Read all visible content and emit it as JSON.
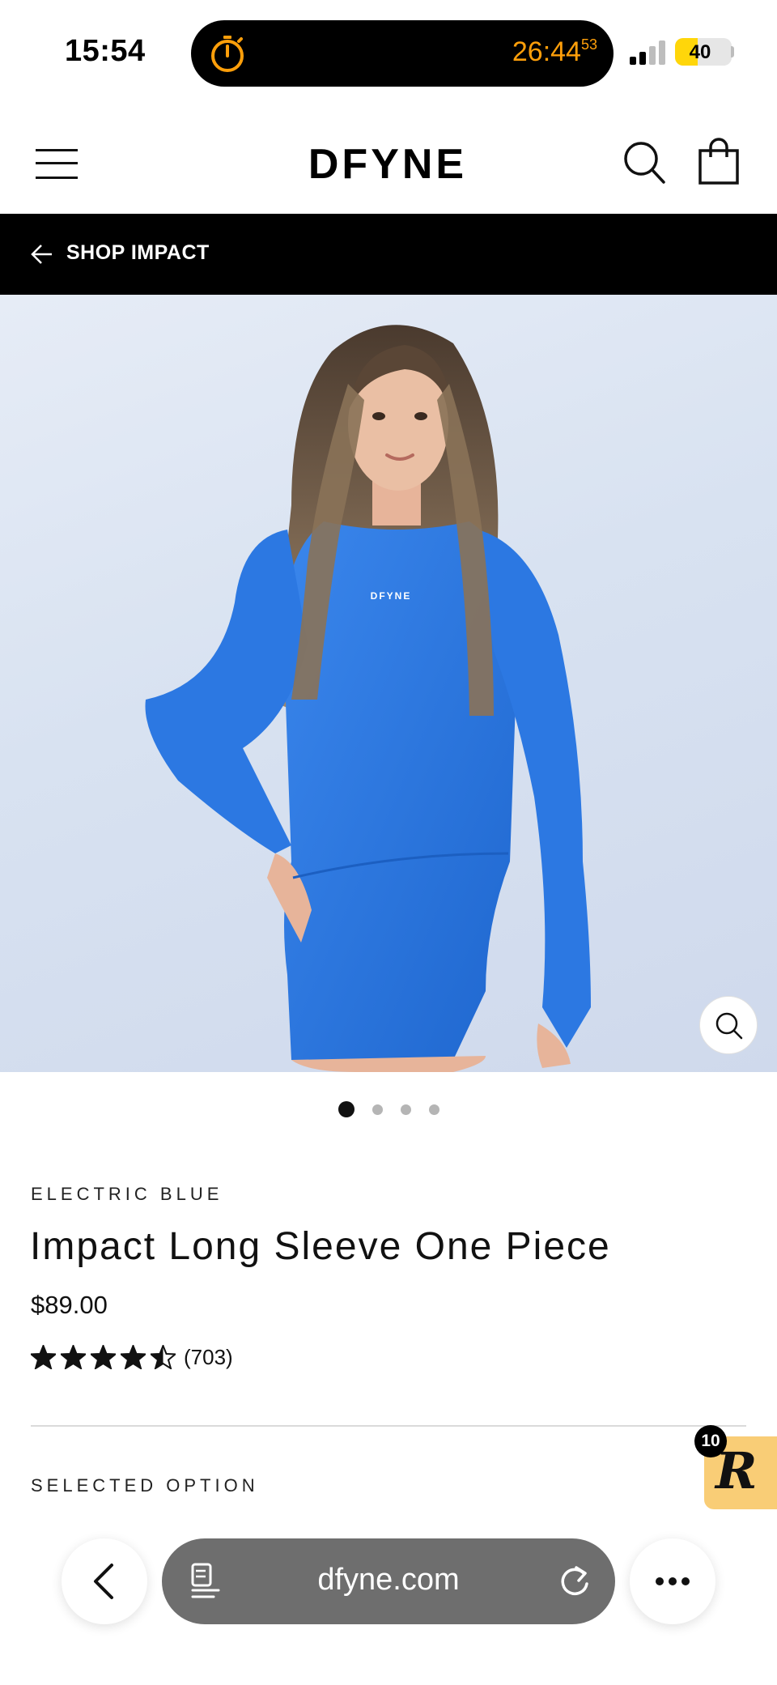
{
  "status_bar": {
    "time": "15:54",
    "timer": "26:44",
    "timer_fraction": "53",
    "battery_level": "40",
    "battery_percent": 40,
    "timer_color": "#ff9f0a",
    "battery_color": "#ffd60a"
  },
  "header": {
    "logo_text": "DFYNE"
  },
  "back_nav": {
    "label": "SHOP IMPACT"
  },
  "gallery": {
    "image_count": 4,
    "active_index": 0,
    "print_text": "DFYNE",
    "garment_color": "#2f7be0"
  },
  "product": {
    "variant": "ELECTRIC BLUE",
    "title": "Impact Long Sleeve One Piece",
    "price": "$89.00",
    "rating": 4.5,
    "review_count": "(703)",
    "selected_option_label": "SELECTED OPTION"
  },
  "rewards_badge": {
    "letter": "R",
    "count": "10",
    "color": "#f9cd76"
  },
  "browser": {
    "url": "dfyne.com"
  }
}
